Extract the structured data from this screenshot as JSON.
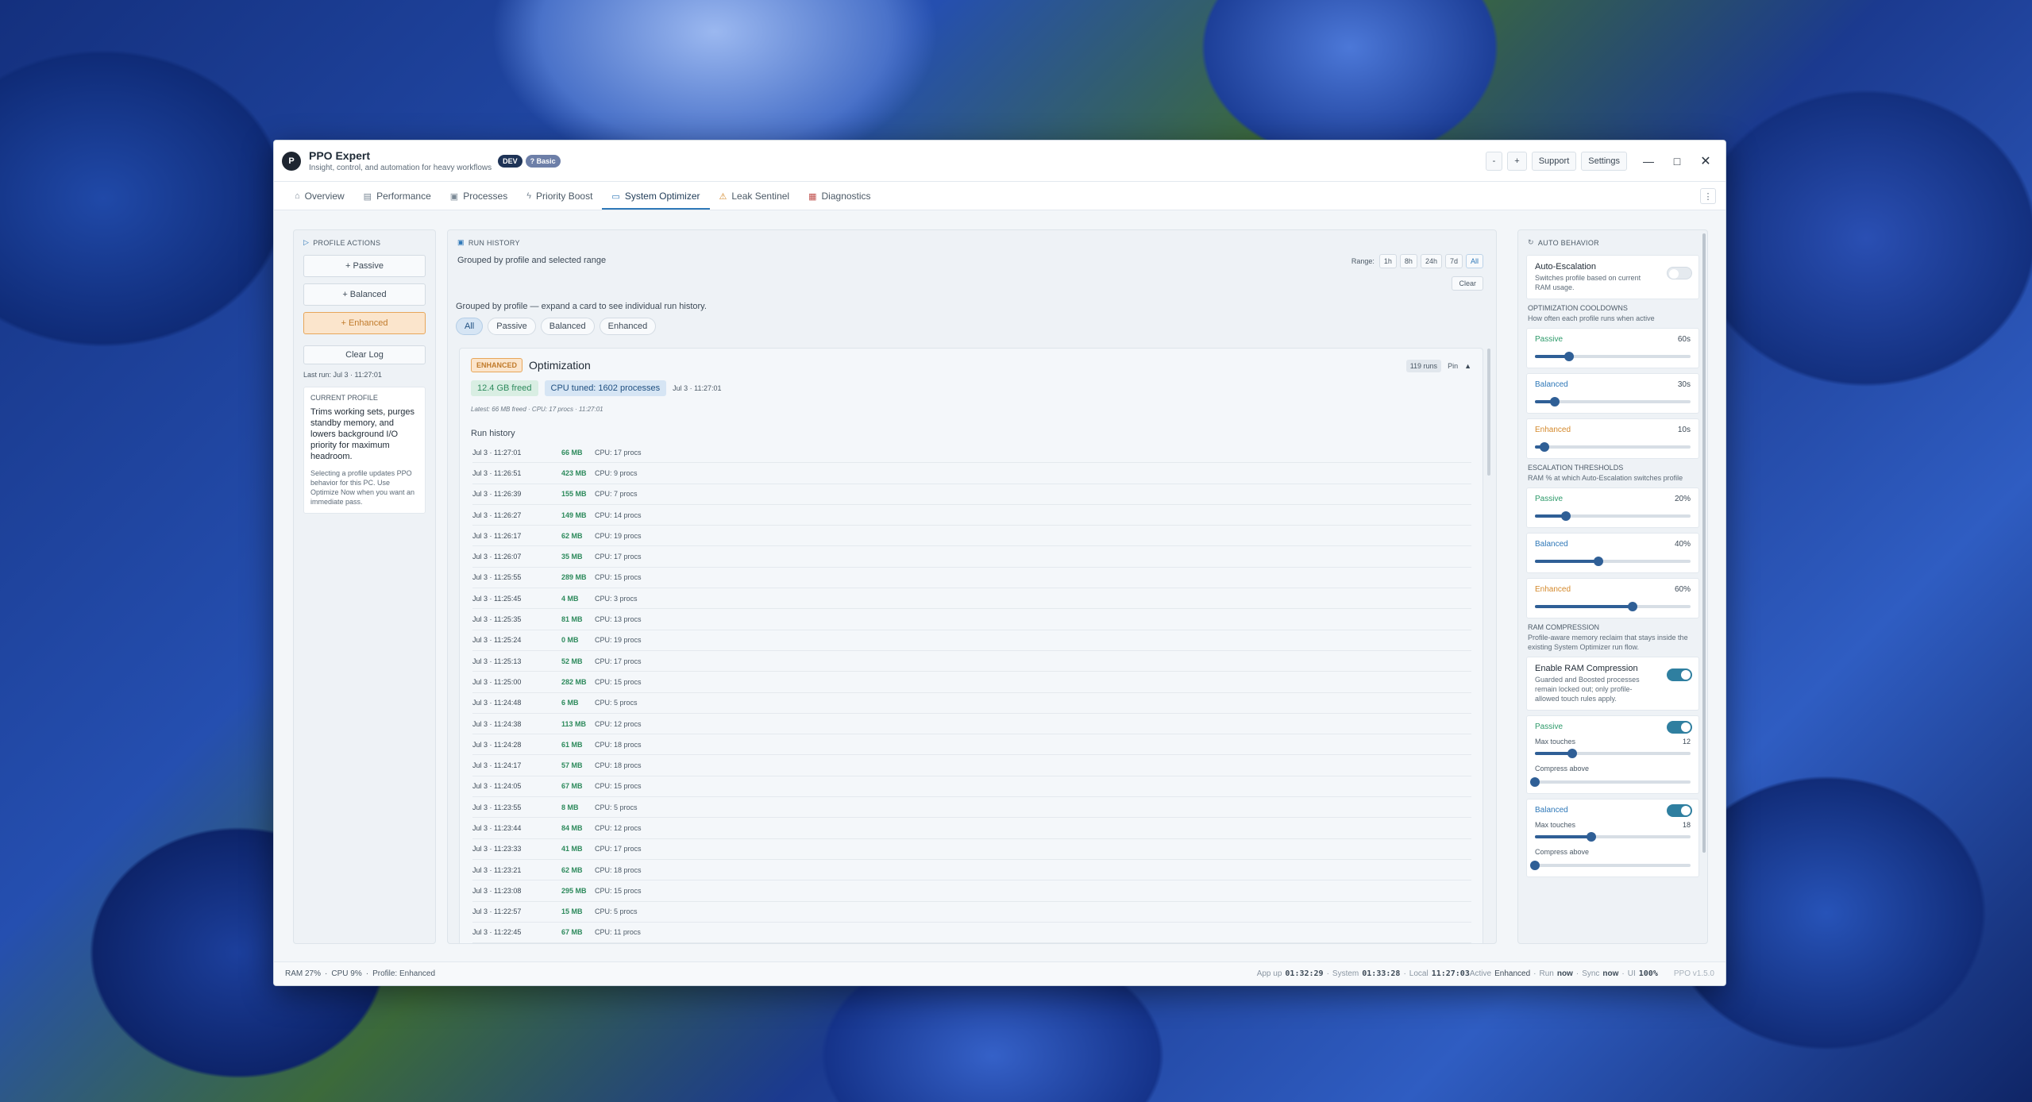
{
  "app": {
    "logo_letter": "P",
    "name": "PPO Expert",
    "subtitle": "Insight, control, and automation for heavy workflows",
    "badge_dev": "DEV",
    "badge_basic": "? Basic"
  },
  "titlebar": {
    "zoom_out": "-",
    "zoom_in": "+",
    "support": "Support",
    "settings": "Settings",
    "minimize": "—",
    "maximize": "□",
    "close": "✕"
  },
  "tabs": [
    {
      "label": "Overview",
      "icon": "home-icon",
      "glyph": "⌂"
    },
    {
      "label": "Performance",
      "icon": "chart-icon",
      "glyph": "▤"
    },
    {
      "label": "Processes",
      "icon": "process-icon",
      "glyph": "▣"
    },
    {
      "label": "Priority Boost",
      "icon": "boost-icon",
      "glyph": "ϟ"
    },
    {
      "label": "System Optimizer",
      "icon": "optimizer-icon",
      "glyph": "▭",
      "active": true
    },
    {
      "label": "Leak Sentinel",
      "icon": "warning-icon",
      "glyph": "⚠"
    },
    {
      "label": "Diagnostics",
      "icon": "diagnostics-icon",
      "glyph": "▦"
    }
  ],
  "tab_more": "⋮",
  "left": {
    "section": "PROFILE ACTIONS",
    "buttons": [
      "+ Passive",
      "+ Balanced",
      "+ Enhanced"
    ],
    "clear_log": "Clear Log",
    "last_run": "Last run: Jul 3 · 11:27:01",
    "current_profile_title": "CURRENT PROFILE",
    "current_profile_text": "Trims working sets, purges standby memory, and lowers background I/O priority for maximum headroom.",
    "current_profile_note": "Selecting a profile updates PPO behavior for this PC. Use Optimize Now when you want an immediate pass."
  },
  "main": {
    "section": "RUN HISTORY",
    "subtitle": "Grouped by profile and selected range",
    "range_label": "Range:",
    "ranges": [
      "1h",
      "8h",
      "24h",
      "7d",
      "All"
    ],
    "clear": "Clear",
    "hint": "Grouped by profile — expand a card to see individual run history.",
    "filters": [
      "All",
      "Passive",
      "Balanced",
      "Enhanced"
    ],
    "card": {
      "badge": "ENHANCED",
      "title": "Optimization",
      "runs": "119 runs",
      "pin": "Pin",
      "collapse": "▲",
      "freed": "12.4 GB freed",
      "cpu_tuned": "CPU tuned: 1602 processes",
      "timestamp": "Jul 3 · 11:27:01",
      "latest": "Latest: 66 MB freed · CPU: 17 procs · 11:27:01",
      "history_label": "Run history",
      "rows": [
        {
          "time": "Jul 3 · 11:27:01",
          "mb": "66 MB",
          "cpu": "CPU: 17 procs"
        },
        {
          "time": "Jul 3 · 11:26:51",
          "mb": "423 MB",
          "cpu": "CPU: 9 procs"
        },
        {
          "time": "Jul 3 · 11:26:39",
          "mb": "155 MB",
          "cpu": "CPU: 7 procs"
        },
        {
          "time": "Jul 3 · 11:26:27",
          "mb": "149 MB",
          "cpu": "CPU: 14 procs"
        },
        {
          "time": "Jul 3 · 11:26:17",
          "mb": "62 MB",
          "cpu": "CPU: 19 procs"
        },
        {
          "time": "Jul 3 · 11:26:07",
          "mb": "35 MB",
          "cpu": "CPU: 17 procs"
        },
        {
          "time": "Jul 3 · 11:25:55",
          "mb": "289 MB",
          "cpu": "CPU: 15 procs"
        },
        {
          "time": "Jul 3 · 11:25:45",
          "mb": "4 MB",
          "cpu": "CPU: 3 procs"
        },
        {
          "time": "Jul 3 · 11:25:35",
          "mb": "81 MB",
          "cpu": "CPU: 13 procs"
        },
        {
          "time": "Jul 3 · 11:25:24",
          "mb": "0 MB",
          "cpu": "CPU: 19 procs"
        },
        {
          "time": "Jul 3 · 11:25:13",
          "mb": "52 MB",
          "cpu": "CPU: 17 procs"
        },
        {
          "time": "Jul 3 · 11:25:00",
          "mb": "282 MB",
          "cpu": "CPU: 15 procs"
        },
        {
          "time": "Jul 3 · 11:24:48",
          "mb": "6 MB",
          "cpu": "CPU: 5 procs"
        },
        {
          "time": "Jul 3 · 11:24:38",
          "mb": "113 MB",
          "cpu": "CPU: 12 procs"
        },
        {
          "time": "Jul 3 · 11:24:28",
          "mb": "61 MB",
          "cpu": "CPU: 18 procs"
        },
        {
          "time": "Jul 3 · 11:24:17",
          "mb": "57 MB",
          "cpu": "CPU: 18 procs"
        },
        {
          "time": "Jul 3 · 11:24:05",
          "mb": "67 MB",
          "cpu": "CPU: 15 procs"
        },
        {
          "time": "Jul 3 · 11:23:55",
          "mb": "8 MB",
          "cpu": "CPU: 5 procs"
        },
        {
          "time": "Jul 3 · 11:23:44",
          "mb": "84 MB",
          "cpu": "CPU: 12 procs"
        },
        {
          "time": "Jul 3 · 11:23:33",
          "mb": "41 MB",
          "cpu": "CPU: 17 procs"
        },
        {
          "time": "Jul 3 · 11:23:21",
          "mb": "62 MB",
          "cpu": "CPU: 18 procs"
        },
        {
          "time": "Jul 3 · 11:23:08",
          "mb": "295 MB",
          "cpu": "CPU: 15 procs"
        },
        {
          "time": "Jul 3 · 11:22:57",
          "mb": "15 MB",
          "cpu": "CPU: 5 procs"
        },
        {
          "time": "Jul 3 · 11:22:45",
          "mb": "67 MB",
          "cpu": "CPU: 11 procs"
        }
      ]
    }
  },
  "right": {
    "section": "AUTO BEHAVIOR",
    "auto_escalation_title": "Auto-Escalation",
    "auto_escalation_desc": "Switches profile based on current RAM usage.",
    "auto_escalation_on": false,
    "cooldowns_title": "OPTIMIZATION COOLDOWNS",
    "cooldowns_desc": "How often each profile runs when active",
    "cooldowns": [
      {
        "name": "Passive",
        "value": "60s",
        "level": 0.22,
        "color": "#2d9a6a"
      },
      {
        "name": "Balanced",
        "value": "30s",
        "level": 0.13,
        "color": "#2f78b8"
      },
      {
        "name": "Enhanced",
        "value": "10s",
        "level": 0.06,
        "color": "#d4892c"
      }
    ],
    "thresholds_title": "ESCALATION THRESHOLDS",
    "thresholds_desc": "RAM % at which Auto-Escalation switches profile",
    "thresholds": [
      {
        "name": "Passive",
        "value": "20%",
        "level": 0.2,
        "color": "#2d9a6a"
      },
      {
        "name": "Balanced",
        "value": "40%",
        "level": 0.41,
        "color": "#2f78b8"
      },
      {
        "name": "Enhanced",
        "value": "60%",
        "level": 0.63,
        "color": "#d4892c"
      }
    ],
    "compression_title": "RAM COMPRESSION",
    "compression_desc": "Profile-aware memory reclaim that stays inside the existing System Optimizer run flow.",
    "enable_title": "Enable RAM Compression",
    "enable_desc": "Guarded and Boosted processes remain locked out; only profile-allowed touch rules apply.",
    "compression_profiles": [
      {
        "name": "Passive",
        "color": "#2d9a6a",
        "max_label": "Max touches",
        "max_value": "12",
        "max_level": 0.24,
        "compress_label": "Compress above",
        "compress_level": 0.0
      },
      {
        "name": "Balanced",
        "color": "#2f78b8",
        "max_label": "Max touches",
        "max_value": "18",
        "max_level": 0.36,
        "compress_label": "Compress above",
        "compress_level": 0.0
      }
    ]
  },
  "status": {
    "ram": "RAM 27%",
    "cpu": "CPU 9%",
    "profile": "Profile: Enhanced",
    "app_up_label": "App up",
    "app_up": "01:32:29",
    "system_label": "System",
    "system": "01:33:28",
    "local_label": "Local",
    "local": "11:27:03",
    "active_label": "Active",
    "active": "Enhanced",
    "run_label": "Run",
    "run": "now",
    "sync_label": "Sync",
    "sync": "now",
    "ui_label": "UI",
    "ui": "100%",
    "version": "PPO v1.5.0"
  },
  "colors": {
    "accent": "#2f78b8",
    "enhanced": "#d4892c",
    "passive": "#2d9a6a",
    "freed_green": "#2d8a5c"
  }
}
